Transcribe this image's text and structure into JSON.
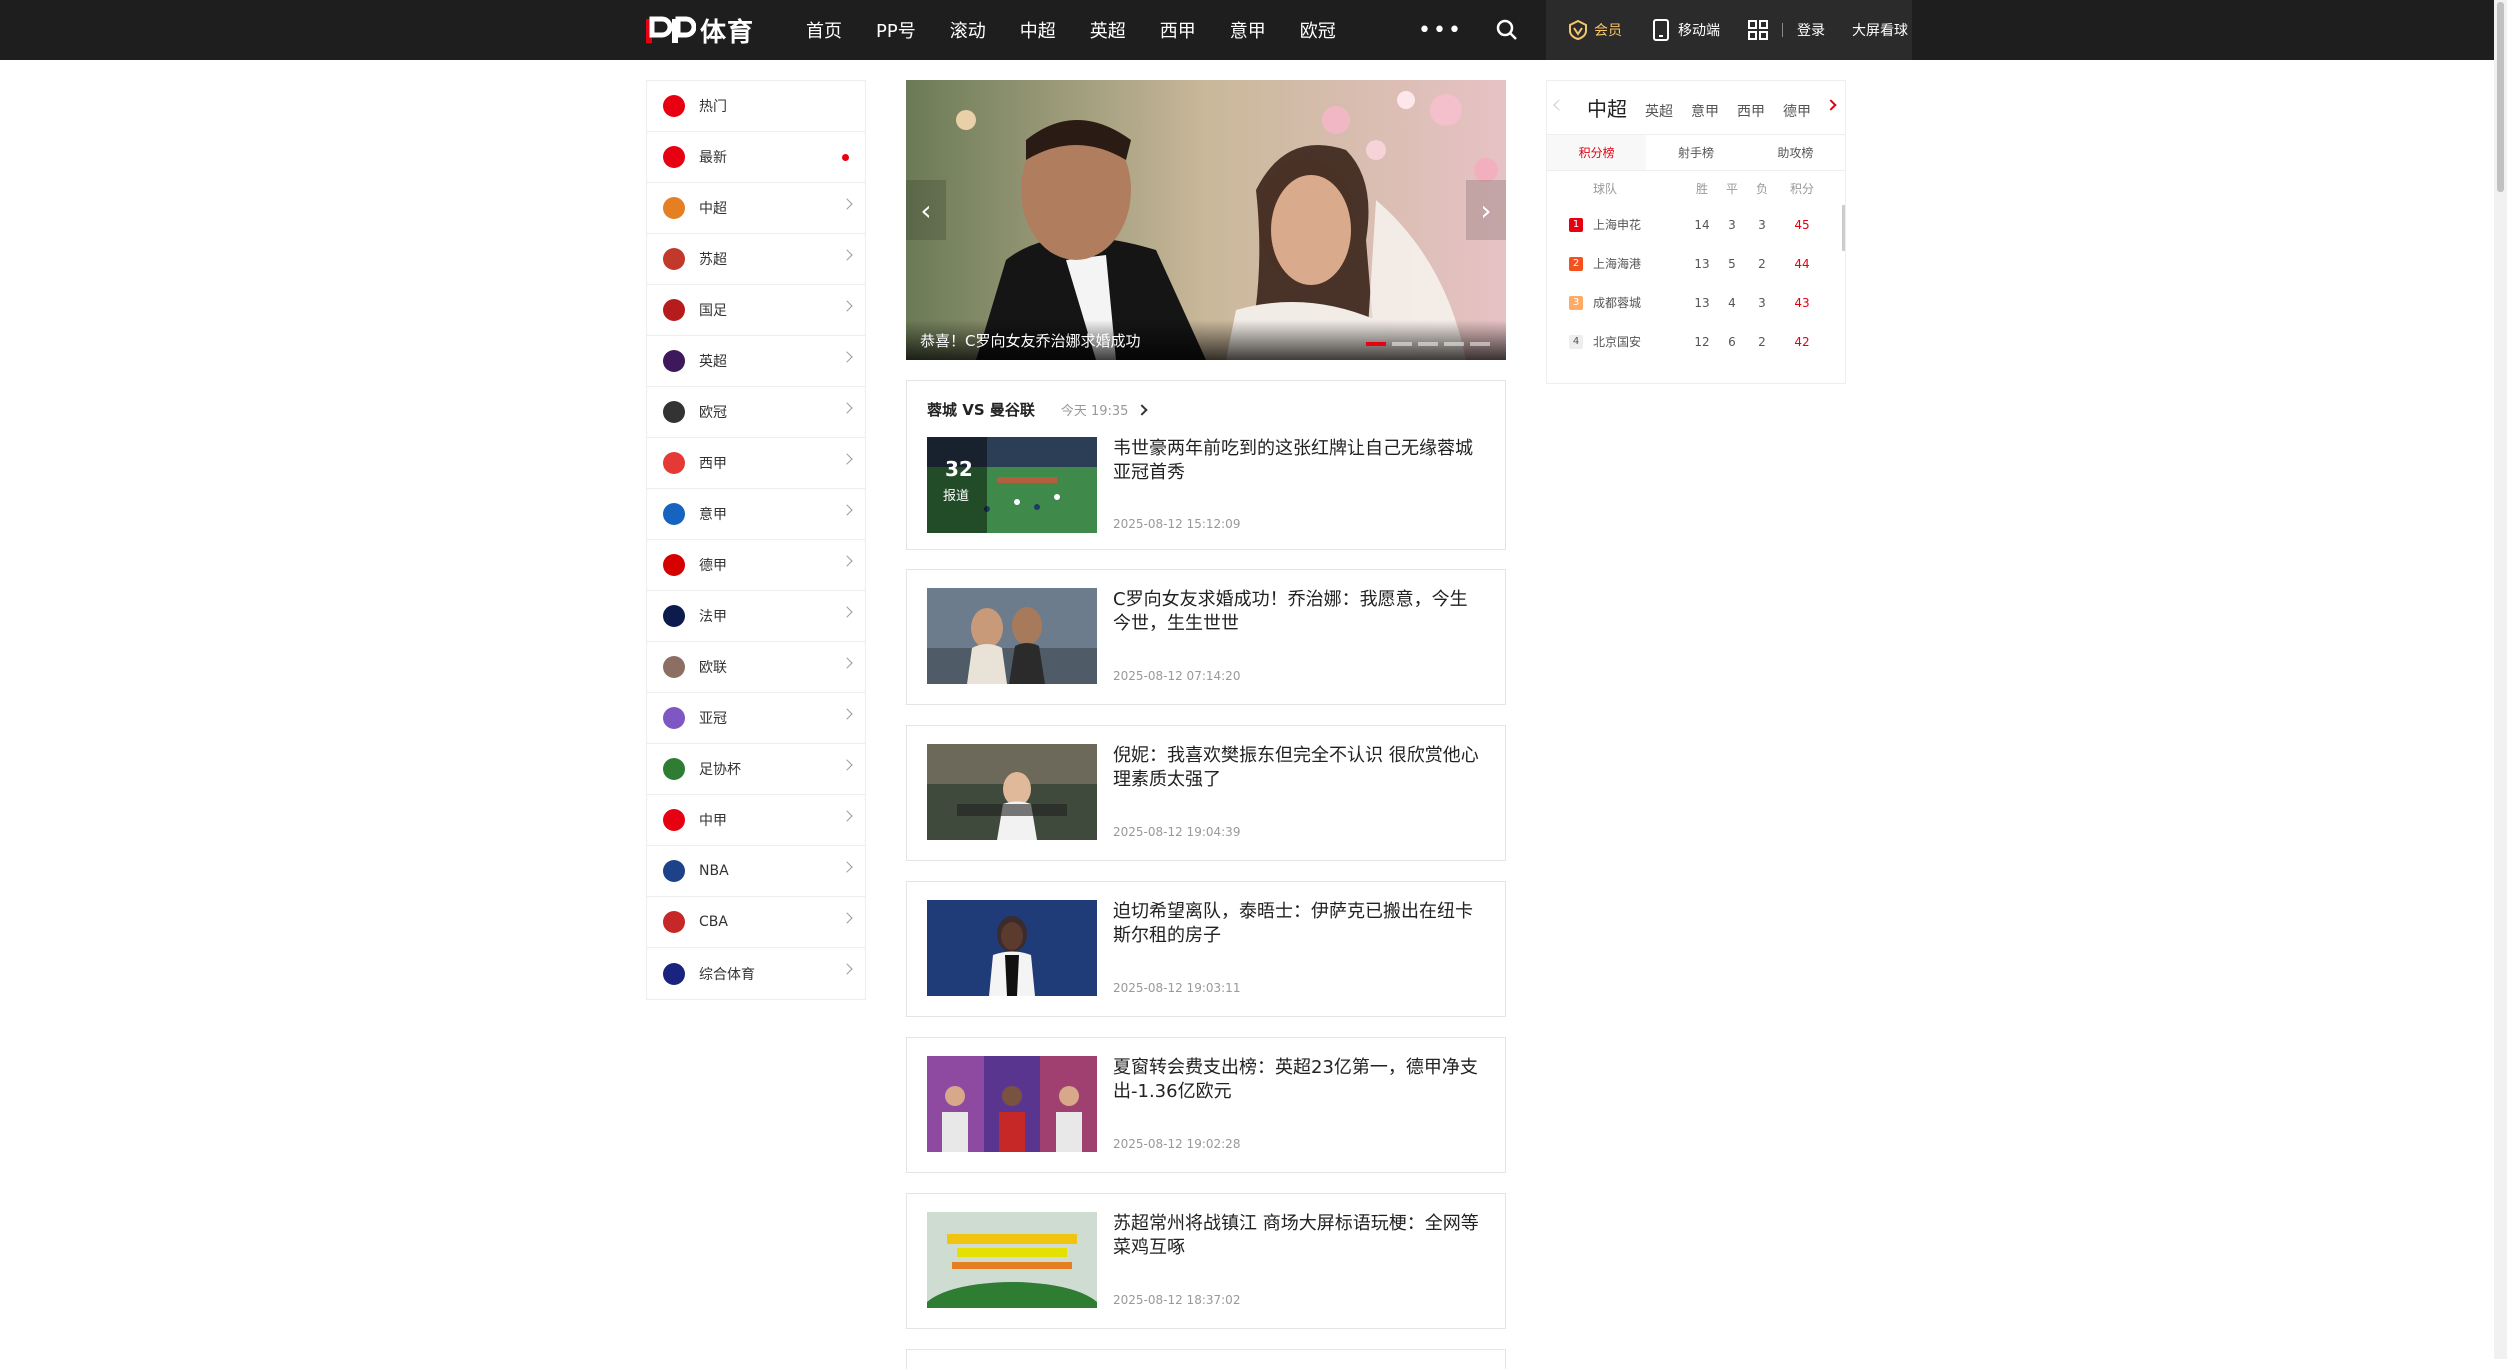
{
  "header": {
    "logo_text": "体育",
    "nav": [
      "首页",
      "PP号",
      "滚动",
      "中超",
      "英超",
      "西甲",
      "意甲",
      "欧冠"
    ],
    "more": "•••",
    "vip_label": "会员",
    "mobile_label": "移动端",
    "login_label": "登录",
    "bigscreen_label": "大屏看球"
  },
  "sidebar": {
    "items": [
      {
        "label": "热门",
        "icon": "flame-icon",
        "color": "#e60012"
      },
      {
        "label": "最新",
        "icon": "new-icon",
        "color": "#e60012",
        "dot": true
      },
      {
        "label": "中超",
        "icon": "csl-icon",
        "color": "#e67e22"
      },
      {
        "label": "苏超",
        "icon": "suchao-icon",
        "color": "#c0392b"
      },
      {
        "label": "国足",
        "icon": "china-team-icon",
        "color": "#b71c1c"
      },
      {
        "label": "英超",
        "icon": "premier-league-icon",
        "color": "#3d195b"
      },
      {
        "label": "欧冠",
        "icon": "champions-league-icon",
        "color": "#333333"
      },
      {
        "label": "西甲",
        "icon": "laliga-icon",
        "color": "#e53935"
      },
      {
        "label": "意甲",
        "icon": "serie-a-icon",
        "color": "#1565c0"
      },
      {
        "label": "德甲",
        "icon": "bundesliga-icon",
        "color": "#d50000"
      },
      {
        "label": "法甲",
        "icon": "ligue1-icon",
        "color": "#0d1b4c"
      },
      {
        "label": "欧联",
        "icon": "europa-league-icon",
        "color": "#8d6e63"
      },
      {
        "label": "亚冠",
        "icon": "afc-cl-icon",
        "color": "#7e57c2"
      },
      {
        "label": "足协杯",
        "icon": "fa-cup-icon",
        "color": "#2e7d32"
      },
      {
        "label": "中甲",
        "icon": "china-league-one-icon",
        "color": "#e60012"
      },
      {
        "label": "NBA",
        "icon": "nba-icon",
        "color": "#1d428a"
      },
      {
        "label": "CBA",
        "icon": "cba-icon",
        "color": "#c62828"
      },
      {
        "label": "综合体育",
        "icon": "general-sports-icon",
        "color": "#1a237e"
      }
    ]
  },
  "banner": {
    "caption": "恭喜！C罗向女友乔治娜求婚成功",
    "dot_count": 5
  },
  "match": {
    "title": "蓉城 VS 曼谷联",
    "time": "今天 19:35",
    "report_count": "32",
    "report_label": "报道",
    "news_title": "韦世豪两年前吃到的这张红牌让自己无缘蓉城亚冠首秀",
    "news_time": "2025-08-12 15:12:09"
  },
  "news": [
    {
      "title": "C罗向女友求婚成功！乔治娜：我愿意，今生今世，生生世世",
      "time": "2025-08-12 07:14:20"
    },
    {
      "title": "倪妮：我喜欢樊振东但完全不认识 很欣赏他心理素质太强了",
      "time": "2025-08-12 19:04:39"
    },
    {
      "title": "迫切希望离队，泰晤士：伊萨克已搬出在纽卡斯尔租的房子",
      "time": "2025-08-12 19:03:11"
    },
    {
      "title": "夏窗转会费支出榜：英超23亿第一，德甲净支出-1.36亿欧元",
      "time": "2025-08-12 19:02:28"
    },
    {
      "title": "苏超常州将战镇江 商场大屏标语玩梗：全网等菜鸡互啄",
      "time": "2025-08-12 18:37:02"
    }
  ],
  "standings": {
    "leagues": [
      "中超",
      "英超",
      "意甲",
      "西甲",
      "德甲"
    ],
    "sub_tabs": [
      "积分榜",
      "射手榜",
      "助攻榜"
    ],
    "headers": {
      "team": "球队",
      "win": "胜",
      "draw": "平",
      "loss": "负",
      "points": "积分"
    },
    "rows": [
      {
        "rank": "1",
        "team": "上海申花",
        "win": "14",
        "draw": "3",
        "loss": "3",
        "points": "45",
        "color": "#e60012"
      },
      {
        "rank": "2",
        "team": "上海海港",
        "win": "13",
        "draw": "5",
        "loss": "2",
        "points": "44",
        "color": "#f4511e"
      },
      {
        "rank": "3",
        "team": "成都蓉城",
        "win": "13",
        "draw": "4",
        "loss": "3",
        "points": "43",
        "color": "#ffab66"
      },
      {
        "rank": "4",
        "team": "北京国安",
        "win": "12",
        "draw": "6",
        "loss": "2",
        "points": "42",
        "color": "#eeeeee"
      }
    ]
  }
}
